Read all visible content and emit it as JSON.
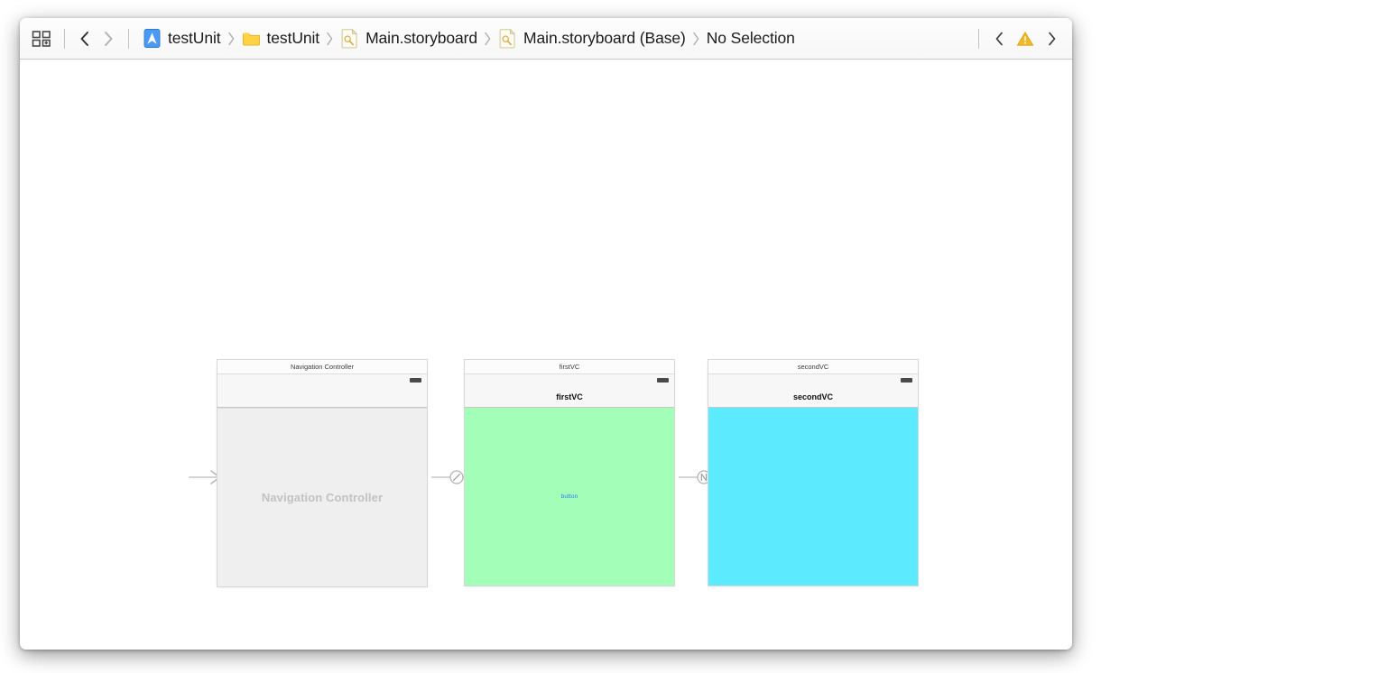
{
  "window": {
    "toolbar": {
      "layout_icon": "grid-layout-icon",
      "back_icon": "chevron-left-icon",
      "forward_icon": "chevron-right-icon",
      "breadcrumbs": [
        {
          "label": "testUnit",
          "icon": "xcode-project-icon"
        },
        {
          "label": "testUnit",
          "icon": "folder-icon"
        },
        {
          "label": "Main.storyboard",
          "icon": "interface-builder-file-icon"
        },
        {
          "label": "Main.storyboard (Base)",
          "icon": "interface-builder-file-icon"
        },
        {
          "label": "No Selection",
          "icon": ""
        }
      ],
      "issue_prev_icon": "chevron-left-icon",
      "issue_warning_icon": "warning-triangle-icon",
      "issue_next_icon": "chevron-right-icon"
    },
    "canvas": {
      "entry_point": {
        "name": "initial-view-controller-arrow",
        "icon": "arrow-right-icon"
      },
      "scenes": [
        {
          "id": "navigation-controller",
          "title": "Navigation Controller",
          "navbar_title": "",
          "placeholder_label": "Navigation Controller",
          "body_kind": "placeholder",
          "body_color": "#efefef",
          "button_label": ""
        },
        {
          "id": "first-vc",
          "title": "firstVC",
          "navbar_title": "firstVC",
          "placeholder_label": "",
          "body_kind": "tinted",
          "body_color": "#a3ffb8",
          "button_label": "button"
        },
        {
          "id": "second-vc",
          "title": "secondVC",
          "navbar_title": "secondVC",
          "placeholder_label": "",
          "body_kind": "tinted",
          "body_color": "#5ceaff",
          "button_label": ""
        }
      ],
      "segues": [
        {
          "id": "relationship-segue",
          "kind": "relationship-segue-icon",
          "from": "navigation-controller",
          "to": "first-vc"
        },
        {
          "id": "show-segue",
          "kind": "show-segue-icon",
          "from": "first-vc",
          "to": "second-vc"
        }
      ]
    }
  },
  "colors": {
    "accent_blue": "#2f7bf6",
    "warning_yellow": "#f6b923",
    "first_vc_tint": "#a3ffb8",
    "second_vc_tint": "#5ceaff",
    "placeholder_gray": "#efefef"
  }
}
